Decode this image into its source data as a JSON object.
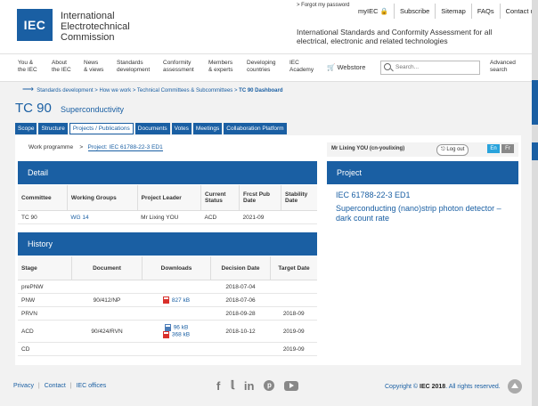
{
  "header": {
    "logo": "IEC",
    "org_line1": "International",
    "org_line2": "Electrotechnical",
    "org_line3": "Commission",
    "forgot": "> Forgot my password",
    "topnav": [
      "myIEC",
      "Subscribe",
      "Sitemap",
      "FAQs",
      "Contact us"
    ],
    "tagline": "International Standards and Conformity Assessment for all electrical, electronic and related technologies"
  },
  "mainnav": {
    "items": [
      {
        "l1": "You &",
        "l2": "the IEC"
      },
      {
        "l1": "About",
        "l2": "the IEC"
      },
      {
        "l1": "News",
        "l2": "& views"
      },
      {
        "l1": "Standards",
        "l2": "development"
      },
      {
        "l1": "Conformity",
        "l2": "assessment"
      },
      {
        "l1": "Members",
        "l2": "& experts"
      },
      {
        "l1": "Developing",
        "l2": "countries"
      },
      {
        "l1": "IEC",
        "l2": "Academy"
      }
    ],
    "webstore": "Webstore",
    "search_placeholder": "Search...",
    "advanced_l1": "Advanced",
    "advanced_l2": "search"
  },
  "breadcrumb": {
    "items": [
      "Standards development",
      "How we work",
      "Technical Committees & Subcommittees"
    ],
    "current": "TC 90 Dashboard",
    "sep": ">"
  },
  "tc": {
    "title": "TC 90",
    "subtitle": "Superconductivity"
  },
  "tabs": [
    "Scope",
    "Structure",
    "Projects / Publications",
    "Documents",
    "Votes",
    "Meetings",
    "Collaboration Platform"
  ],
  "sub": {
    "work_programme": "Work programme",
    "sep": ">",
    "project": "Project: IEC 61788-22-3 ED1",
    "user": "Mr Lixing YOU (cn-youlixing)",
    "logout": "Log out",
    "lang_en": "En",
    "lang_fr": "Fr"
  },
  "detail": {
    "title": "Detail",
    "headers": [
      "Committee",
      "Working Groups",
      "Project Leader",
      "Current Status",
      "Frcst Pub Date",
      "Stability Date"
    ],
    "row": [
      "TC 90",
      "WG 14",
      "Mr Lixing YOU",
      "ACD",
      "2021-09",
      ""
    ]
  },
  "history": {
    "title": "History",
    "headers": [
      "Stage",
      "Document",
      "Downloads",
      "Decision Date",
      "Target Date"
    ],
    "rows": [
      {
        "stage": "prePNW",
        "document": "",
        "dl1": "",
        "dl2": "",
        "decision": "2018-07-04",
        "target": ""
      },
      {
        "stage": "PNW",
        "document": "90/412/NP",
        "dl1": "827 kB",
        "dl2": "",
        "decision": "2018-07-06",
        "target": ""
      },
      {
        "stage": "PRVN",
        "document": "",
        "dl1": "",
        "dl2": "",
        "decision": "2018-09-28",
        "target": "2018-09"
      },
      {
        "stage": "ACD",
        "document": "90/424/RVN",
        "dl1": "96 kB",
        "dl2": "368 kB",
        "decision": "2018-10-12",
        "target": "2019-09"
      },
      {
        "stage": "CD",
        "document": "",
        "dl1": "",
        "dl2": "",
        "decision": "",
        "target": "2019-09"
      }
    ]
  },
  "project": {
    "title": "Project",
    "id": "IEC 61788-22-3 ED1",
    "description": "Superconducting (nano)strip photon detector – dark count rate"
  },
  "footer": {
    "links": [
      "Privacy",
      "Contact",
      "IEC offices"
    ],
    "sep": "|",
    "copyright_pre": "Copyright ©",
    "copyright_bold": "IEC 2018",
    "copyright_post": ". All rights reserved."
  },
  "colors": {
    "brand": "#1a5fa3",
    "lang_en": "#29a3dc",
    "pdf": "#d9302b"
  }
}
